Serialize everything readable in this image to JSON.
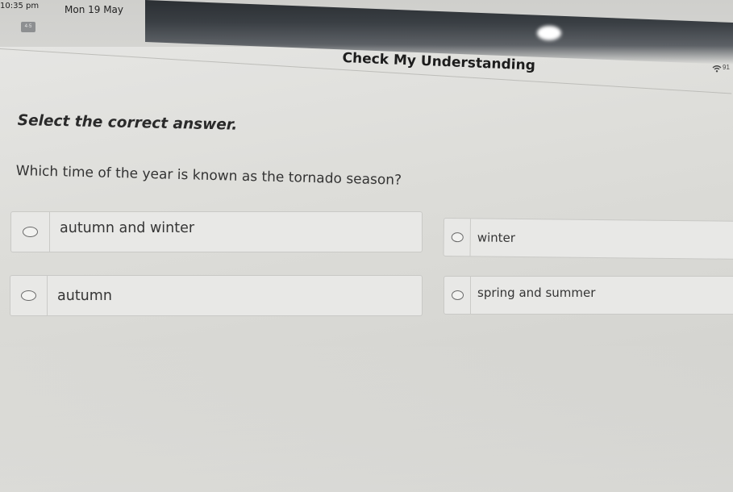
{
  "status_bar": {
    "time": "10:35 pm",
    "date": "Mon 19 May",
    "battery": "91"
  },
  "app_badge": "4·5",
  "header": {
    "title": "Check My Understanding"
  },
  "quiz": {
    "instruction": "Select the correct answer.",
    "question": "Which time of the year is known as the tornado season?",
    "options": [
      {
        "label": "autumn and winter",
        "selected": false
      },
      {
        "label": "winter",
        "selected": false
      },
      {
        "label": "autumn",
        "selected": false
      },
      {
        "label": "spring and summer",
        "selected": false
      }
    ]
  },
  "colors": {
    "background": "#e0e0dd",
    "option_fill": "#e8e8e6",
    "option_border": "#c9c9c6",
    "text": "#2a2a2a"
  },
  "icons": [
    "wifi-icon",
    "radio-icon"
  ]
}
